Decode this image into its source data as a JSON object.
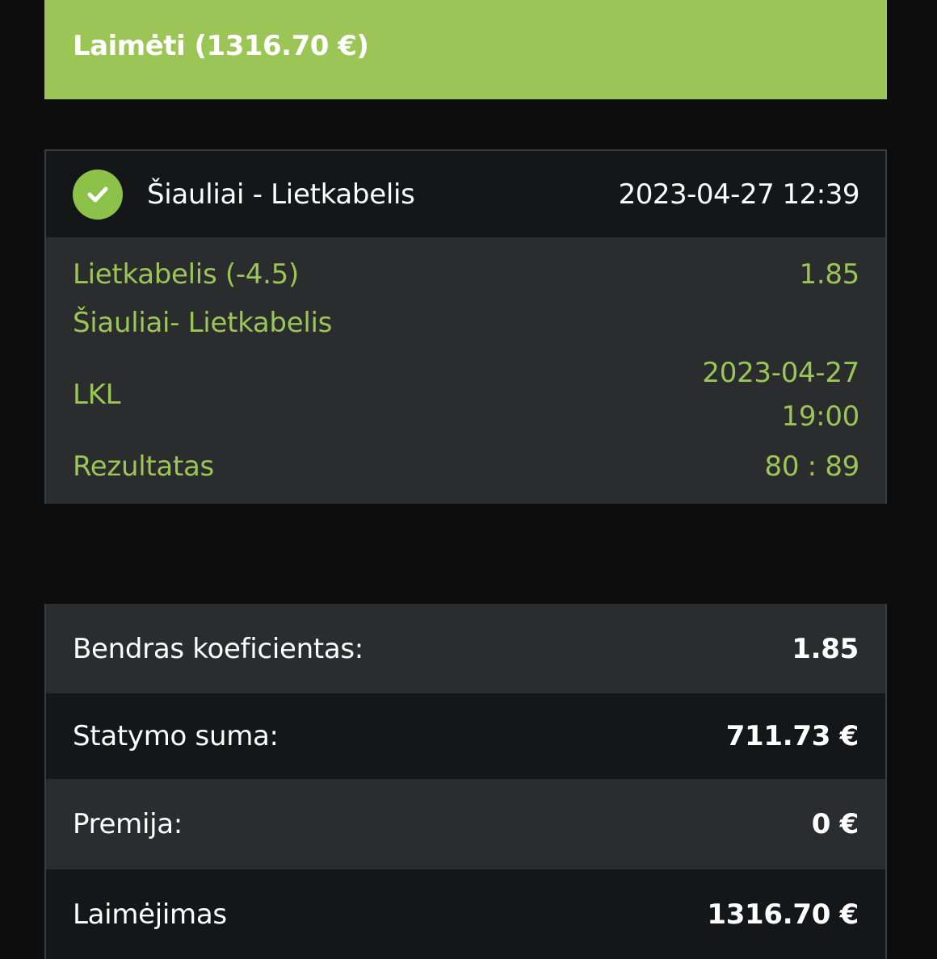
{
  "banner": {
    "label": "Laimėti (1316.70 €)",
    "color": "#9bc556"
  },
  "event": {
    "status_icon": "check-circle-icon",
    "title": "Šiauliai - Lietkabelis",
    "placed_at": "2023-04-27 12:39",
    "selection": "Lietkabelis (-4.5)",
    "odds": "1.85",
    "match": "Šiauliai- Lietkabelis",
    "league": "LKL",
    "match_date": "2023-04-27",
    "match_time": "19:00",
    "result_label": "Rezultatas",
    "result_value": "80 : 89",
    "accent_color": "#9bc556"
  },
  "summary": {
    "total_odds_label": "Bendras koeficientas:",
    "total_odds_value": "1.85",
    "stake_label": "Statymo suma:",
    "stake_value": "711.73 €",
    "bonus_label": "Premija:",
    "bonus_value": "0 €",
    "winnings_label": "Laimėjimas",
    "winnings_value": "1316.70 €"
  }
}
